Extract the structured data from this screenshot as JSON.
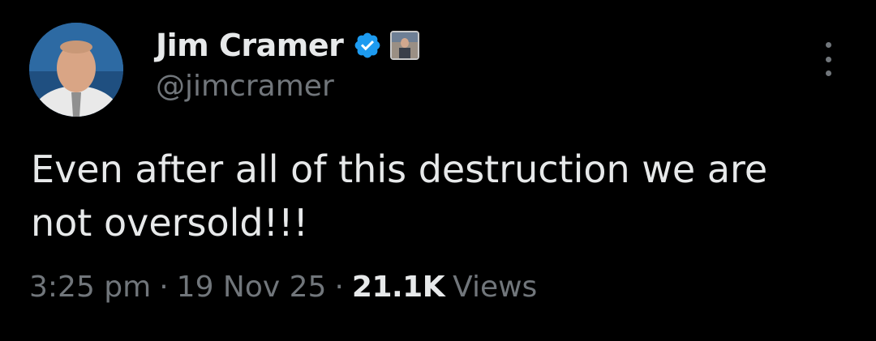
{
  "author": {
    "display_name": "Jim Cramer",
    "handle": "@jimcramer",
    "verified_icon": "verified-badge-icon",
    "affiliate_icon": "affiliate-badge-icon",
    "avatar_icon": "profile-photo-avatar"
  },
  "tweet": {
    "text": "Even after all of this destruction we are\nnot oversold!!!"
  },
  "meta": {
    "time": "3:25 pm",
    "separator": "·",
    "date": "19 Nov 25",
    "views_count": "21.1K",
    "views_label": "Views"
  },
  "menu": {
    "icon": "more-options-icon"
  },
  "colors": {
    "background": "#000000",
    "primary_text": "#e7e9ea",
    "secondary_text": "#71767b",
    "verified_blue": "#1d9bf0"
  }
}
